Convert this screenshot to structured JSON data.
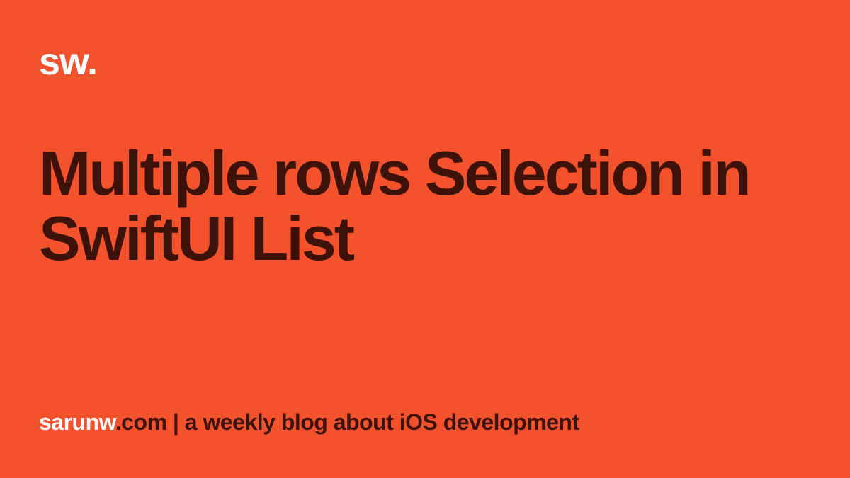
{
  "logo": "sw.",
  "title": "Multiple rows Selection in SwiftUI List",
  "footer": {
    "domain": "sarunw",
    "rest": ".com | a weekly blog about iOS development"
  },
  "colors": {
    "background": "#f4522c",
    "dark_text": "#3d1209",
    "light_text": "#ffffff"
  }
}
